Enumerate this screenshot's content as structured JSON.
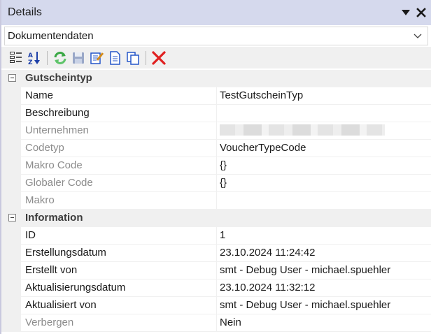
{
  "window": {
    "title": "Details",
    "dropdown_icon": "triangle-down-icon",
    "close_icon": "close-icon"
  },
  "selector": {
    "value": "Dokumentendaten"
  },
  "toolbar": {
    "buttons": [
      "categorized-view-icon",
      "sort-alphabetical-icon",
      "refresh-icon",
      "save-icon",
      "edit-icon",
      "new-document-icon",
      "copy-icon",
      "delete-icon"
    ]
  },
  "grid": {
    "categories": [
      {
        "label": "Gutscheintyp",
        "rows": [
          {
            "name": "Name",
            "value": "TestGutscheinTyp",
            "readonly": false
          },
          {
            "name": "Beschreibung",
            "value": "",
            "readonly": false
          },
          {
            "name": "Unternehmen",
            "value": "",
            "readonly": true
          },
          {
            "name": "Codetyp",
            "value": "VoucherTypeCode",
            "readonly": true
          },
          {
            "name": "Makro Code",
            "value": "{}",
            "readonly": true
          },
          {
            "name": "Globaler Code",
            "value": "{}",
            "readonly": true
          },
          {
            "name": "Makro",
            "value": "",
            "readonly": true
          }
        ]
      },
      {
        "label": "Information",
        "rows": [
          {
            "name": "ID",
            "value": "1",
            "readonly": false
          },
          {
            "name": "Erstellungsdatum",
            "value": "23.10.2024 11:24:42",
            "readonly": false
          },
          {
            "name": "Erstellt von",
            "value": "smt - Debug User - michael.spuehler",
            "readonly": false
          },
          {
            "name": "Aktualisierungsdatum",
            "value": "23.10.2024 11:32:12",
            "readonly": false
          },
          {
            "name": "Aktualisiert von",
            "value": "smt - Debug User - michael.spuehler",
            "readonly": false
          },
          {
            "name": "Verbergen",
            "value": "Nein",
            "readonly": true
          }
        ]
      }
    ]
  },
  "colors": {
    "titlebar": "#d5d9ed",
    "category_bg": "#f0f0f0",
    "disabled_text": "#8c8c8c",
    "delete_red": "#e02020",
    "refresh_green": "#3aa845"
  }
}
